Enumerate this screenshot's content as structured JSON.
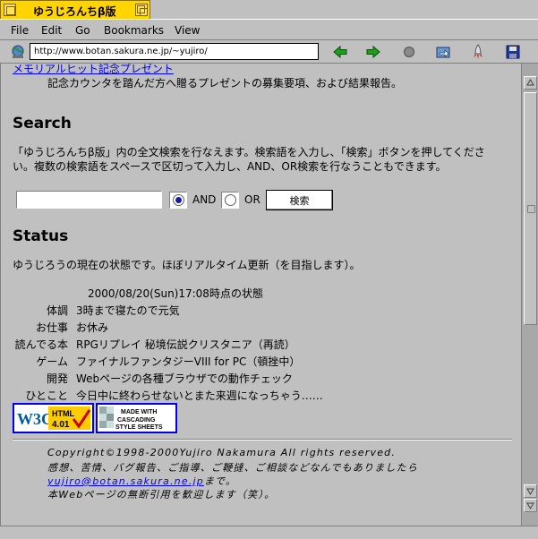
{
  "window": {
    "title": "ゆうじろんちβ版"
  },
  "menu": [
    "File",
    "Edit",
    "Go",
    "Bookmarks",
    "View"
  ],
  "toolbar": {
    "url": "http://www.botan.sakura.ne.jp/~yujiro/"
  },
  "content": {
    "top_link": "メモリアルヒット記念プレゼント",
    "top_desc": "記念カウンタを踏んだ方へ贈るプレゼントの募集要項、および結果報告。",
    "search": {
      "heading": "Search",
      "desc_line1": "「ゆうじろんちβ版」内の全文検索を行なえます。検索語を入力し、「検索」ボタンを押してくださ",
      "desc_line2": "い。複数の検索語をスペースで区切って入力し、AND、OR検索を行なうこともできます。",
      "input_value": "",
      "and_label": "AND",
      "or_label": "OR",
      "button_label": "検索"
    },
    "status": {
      "heading": "Status",
      "desc": "ゆうじろうの現在の状態です。ほぼリアルタイム更新（を目指します）。",
      "timestamp": "2000/08/20(Sun)17:08時点の状態",
      "rows": [
        {
          "label": "体調",
          "value": "3時まで寝たので元気"
        },
        {
          "label": "お仕事",
          "value": "お休み"
        },
        {
          "label": "読んでる本",
          "value": "RPGリプレイ 秘境伝説クリスタニア（再読）"
        },
        {
          "label": "ゲーム",
          "value": "ファイナルファンタジーVIII for PC（頓挫中）"
        },
        {
          "label": "開発",
          "value": "Webページの各種ブラウザでの動作チェック"
        },
        {
          "label": "ひとこと",
          "value": "今日中に終わらせないとまた来週になっちゃう……"
        }
      ]
    },
    "badges": {
      "w3c_text": "W3C",
      "html_text": "HTML",
      "html_version": "4.01",
      "css_line1": "MADE WITH",
      "css_line2": "CASCADING",
      "css_line3": "STYLE SHEETS"
    },
    "footer": {
      "line1": "Copyright©1998-2000Yujiro Nakamura All rights reserved.",
      "line2": "感想、苦情、バグ報告、ご指導、ご鞭撻、ご相談などなんでもありましたら",
      "email": "yujiro@botan.sakura.ne.jp",
      "line3_suffix": "まで。",
      "line4": "本Webページの無断引用を歓迎します（笑）。"
    }
  },
  "colors": {
    "title_tab": "#ffd400",
    "link": "#0000ee",
    "chrome": "#c0c0c0"
  }
}
